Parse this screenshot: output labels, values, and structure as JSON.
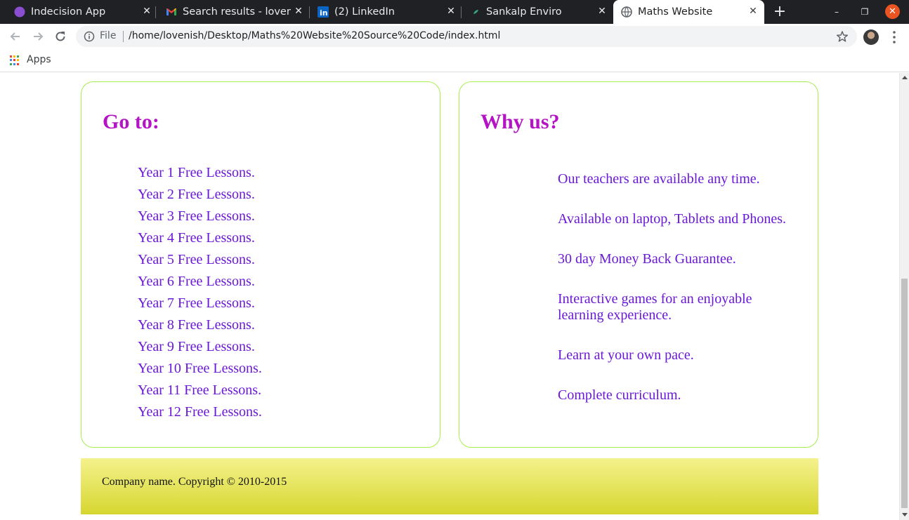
{
  "browser": {
    "tabs": [
      {
        "title": "Indecision App",
        "icon": "purple-circle-icon",
        "active": false
      },
      {
        "title": "Search results - lovenish",
        "icon": "gmail-icon",
        "active": false
      },
      {
        "title": "(2) LinkedIn",
        "icon": "linkedin-icon",
        "active": false
      },
      {
        "title": "Sankalp Enviro",
        "icon": "leaf-icon",
        "active": false
      },
      {
        "title": "Maths Website",
        "icon": "globe-icon",
        "active": true
      }
    ],
    "new_tab": "+",
    "window_controls": {
      "minimize": "–",
      "restore": "❐",
      "close": "✕"
    },
    "address": {
      "scheme_label": "File",
      "url": "/home/lovenish/Desktop/Maths%20Website%20Source%20Code/index.html"
    },
    "bookmarks": {
      "apps_label": "Apps"
    }
  },
  "page": {
    "goto": {
      "heading": "Go to:",
      "items": [
        "Year 1 Free Lessons.",
        "Year 2 Free Lessons.",
        "Year 3 Free Lessons.",
        "Year 4 Free Lessons.",
        "Year 5 Free Lessons.",
        "Year 6 Free Lessons.",
        "Year 7 Free Lessons.",
        "Year 8 Free Lessons.",
        "Year 9 Free Lessons.",
        "Year 10 Free Lessons.",
        "Year 11 Free Lessons.",
        "Year 12 Free Lessons."
      ]
    },
    "why": {
      "heading": "Why us?",
      "items": [
        "Our teachers are available any time.",
        "Available on laptop, Tablets and Phones.",
        "30 day Money Back Guarantee.",
        "Interactive games for an enjoyable learning experience.",
        "Learn at your own pace.",
        "Complete curriculum."
      ]
    },
    "footer": {
      "text": "Company name. Copyright © 2010-2015"
    }
  },
  "colors": {
    "heading": "#b414c4",
    "link": "#6a18d8",
    "panel_border": "#a8ef50",
    "footer_top": "#f4f28c",
    "footer_bottom": "#d6d630"
  }
}
